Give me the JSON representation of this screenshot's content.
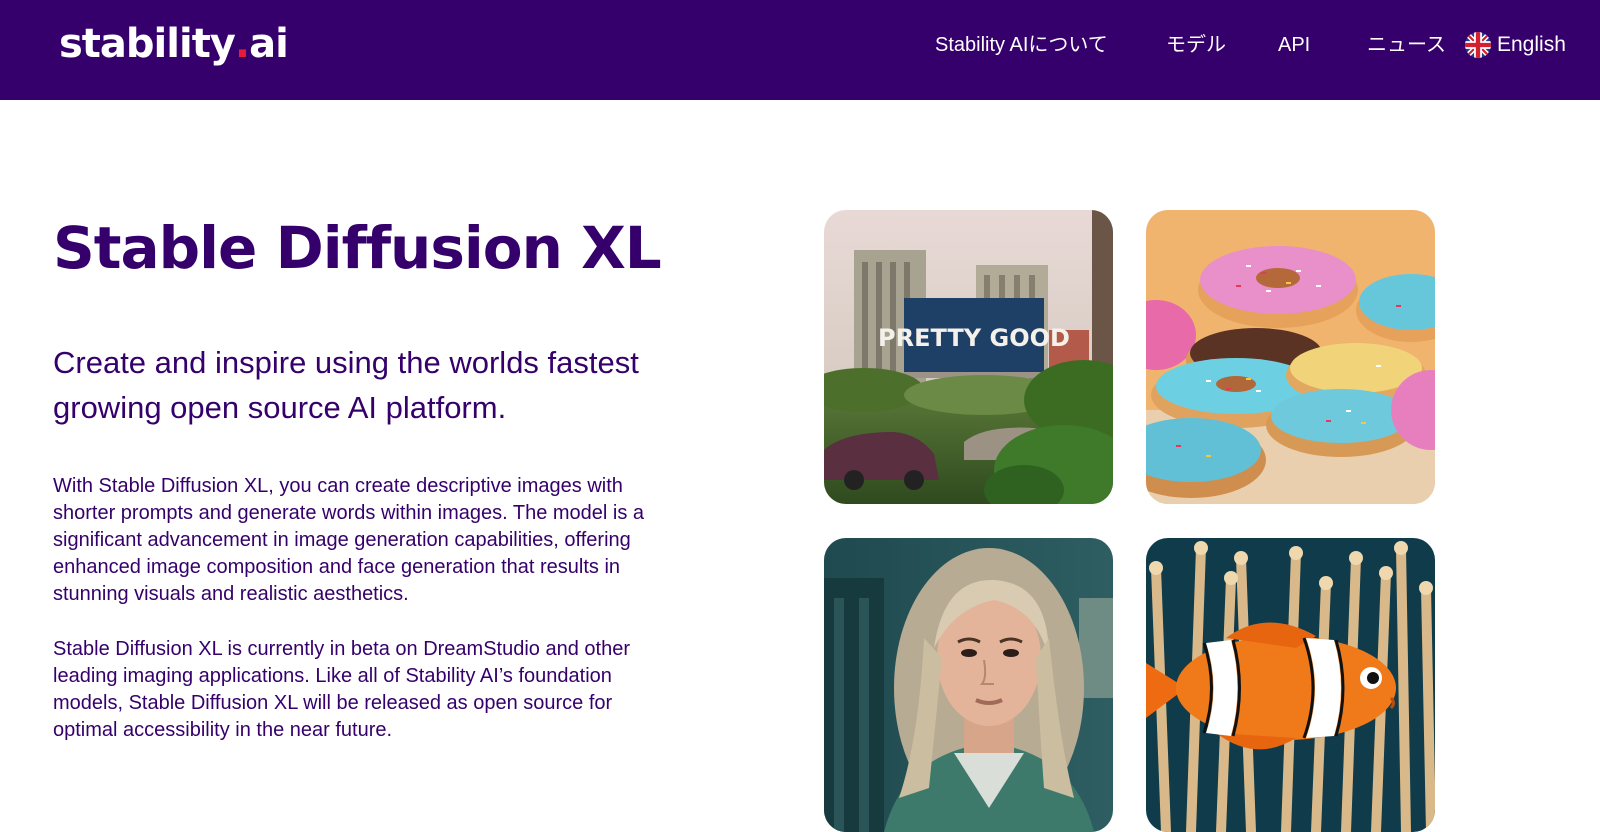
{
  "header": {
    "logo": {
      "main": "stability",
      "dot": ".",
      "suffix": "ai"
    },
    "nav": [
      {
        "label": "Stability AIについて"
      },
      {
        "label": "モデル"
      },
      {
        "label": "API"
      },
      {
        "label": "ニュース"
      }
    ],
    "language": {
      "label": "English",
      "icon": "uk-flag-icon"
    }
  },
  "hero": {
    "title": "Stable Diffusion XL",
    "subtitle_line1": "Create and inspire using the worlds fastest",
    "subtitle_line2": "growing open source AI platform.",
    "paragraph1": "With Stable Diffusion XL, you can create descriptive images with shorter prompts and generate words within images. The model is a significant advancement in image generation capabilities, offering enhanced image composition and face generation that results in stunning visuals and realistic aesthetics.",
    "paragraph2": "Stable Diffusion XL is currently in beta on DreamStudio and other leading imaging applications. Like all of Stability AI’s foundation models, Stable Diffusion XL will be released as open source for optimal accessibility in the near future."
  },
  "gallery": {
    "billboard_text": "PRETTY GOOD"
  },
  "colors": {
    "brand_purple": "#35006b",
    "accent_red": "#e51c38",
    "background": "#ffffff"
  }
}
